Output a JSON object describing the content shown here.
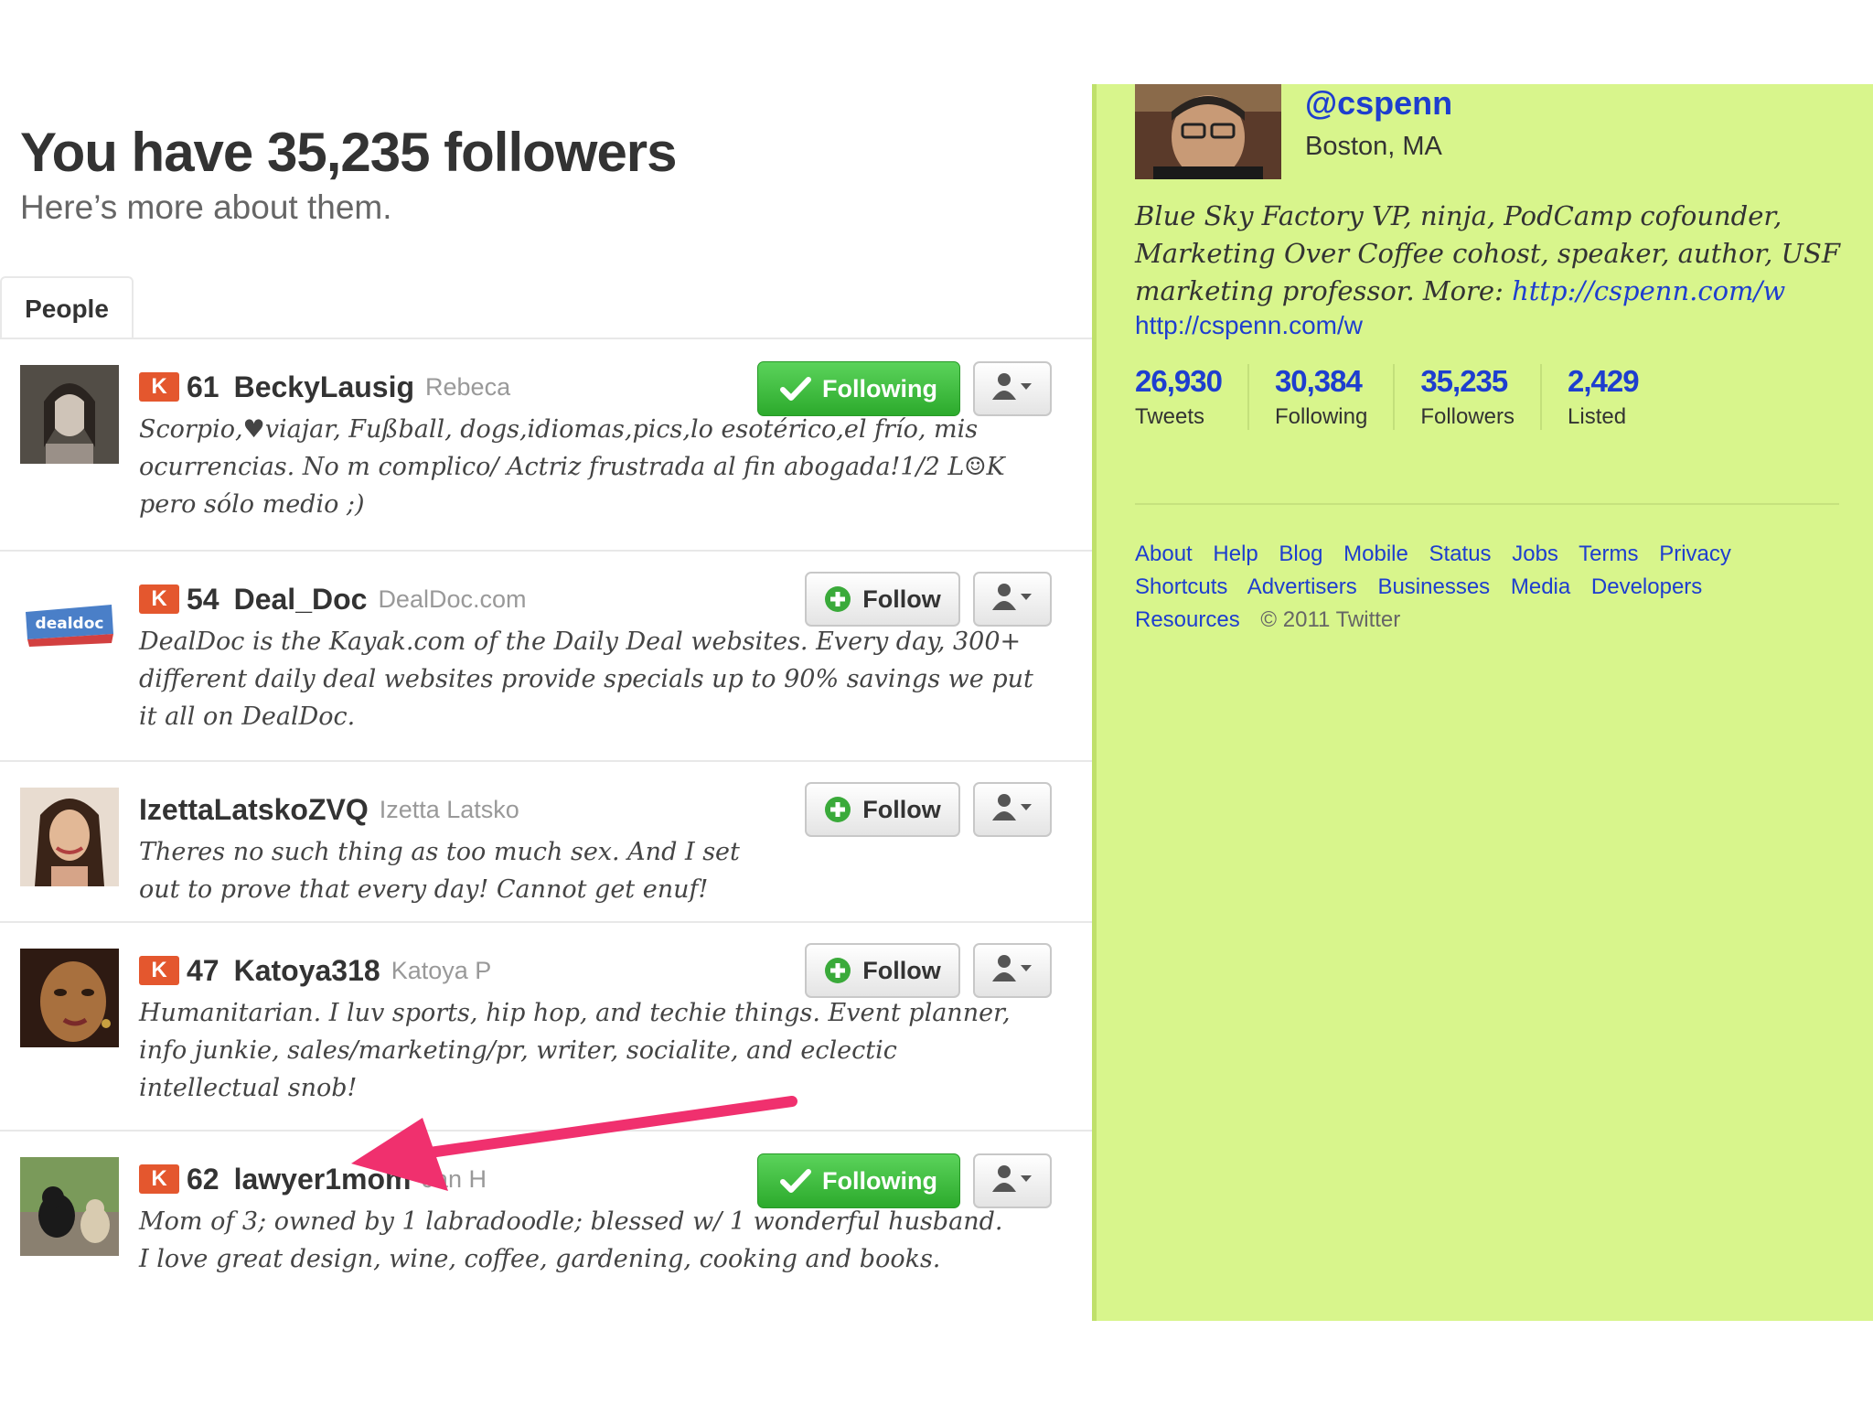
{
  "header": {
    "title": "You have 35,235 followers",
    "subtitle": "Here’s more about them."
  },
  "tabs": [
    {
      "label": "People"
    }
  ],
  "followers": [
    {
      "klout_badge": "K",
      "klout_score": "61",
      "screen_name": "BeckyLausig",
      "full_name": "Rebeca",
      "bio": "Scorpio,♥viajar, Fußball, dogs,idiomas,pics,lo esotérico,el frío, mis ocurrencias. No m complico/ Actriz frustrada al fin abogada!1/2 L☺K pero sólo medio ;)",
      "button_label": "Following",
      "following": true
    },
    {
      "klout_badge": "K",
      "klout_score": "54",
      "screen_name": "Deal_Doc",
      "full_name": "DealDoc.com",
      "bio": "DealDoc is the Kayak.com of the Daily Deal websites. Every day, 300+ different daily deal websites provide specials up to 90% savings we put it all on DealDoc.",
      "button_label": "Follow",
      "following": false,
      "avatar_text": "dealdoc"
    },
    {
      "klout_badge": "",
      "klout_score": "",
      "screen_name": "IzettaLatskoZVQ",
      "full_name": "Izetta Latsko",
      "bio": "Theres no such thing as too much sex. And I set out to prove that every day! Cannot get enuf!",
      "button_label": "Follow",
      "following": false
    },
    {
      "klout_badge": "K",
      "klout_score": "47",
      "screen_name": "Katoya318",
      "full_name": "Katoya P",
      "bio": "Humanitarian. I luv sports, hip hop, and techie things. Event planner, info junkie, sales/marketing/pr, writer, socialite, and eclectic intellectual snob!",
      "button_label": "Follow",
      "following": false
    },
    {
      "klout_badge": "K",
      "klout_score": "62",
      "screen_name": "lawyer1mom",
      "full_name": "Jan H",
      "bio": "Mom of 3; owned by 1 labradoodle; blessed w/ 1 wonderful husband. I love great design, wine, coffee, gardening, cooking and books.",
      "button_label": "Following",
      "following": true
    }
  ],
  "profile": {
    "handle": "@cspenn",
    "location": "Boston, MA",
    "bio": "Blue Sky Factory VP, ninja, PodCamp cofounder, Marketing Over Coffee cohost, speaker, author, USF marketing professor. More:",
    "bio_link": "http://cspenn.com/w",
    "url": "http://cspenn.com/w",
    "stats": [
      {
        "value": "26,930",
        "label": "Tweets"
      },
      {
        "value": "30,384",
        "label": "Following"
      },
      {
        "value": "35,235",
        "label": "Followers"
      },
      {
        "value": "2,429",
        "label": "Listed"
      }
    ]
  },
  "footer": {
    "links": [
      "About",
      "Help",
      "Blog",
      "Mobile",
      "Status",
      "Jobs",
      "Terms",
      "Privacy",
      "Shortcuts",
      "Advertisers",
      "Businesses",
      "Media",
      "Developers",
      "Resources"
    ],
    "copyright": "© 2011 Twitter"
  },
  "icons": {
    "follow": "plus-circle-icon",
    "following": "checkmark-icon",
    "user_menu": "user-dropdown-icon",
    "klout": "klout-badge-icon"
  },
  "colors": {
    "sidebar_bg": "#d8f58c",
    "link": "#1e3ecf",
    "following_button": "#2caa2c",
    "klout_badge": "#e4572e",
    "annotation_arrow": "#f0306e"
  }
}
